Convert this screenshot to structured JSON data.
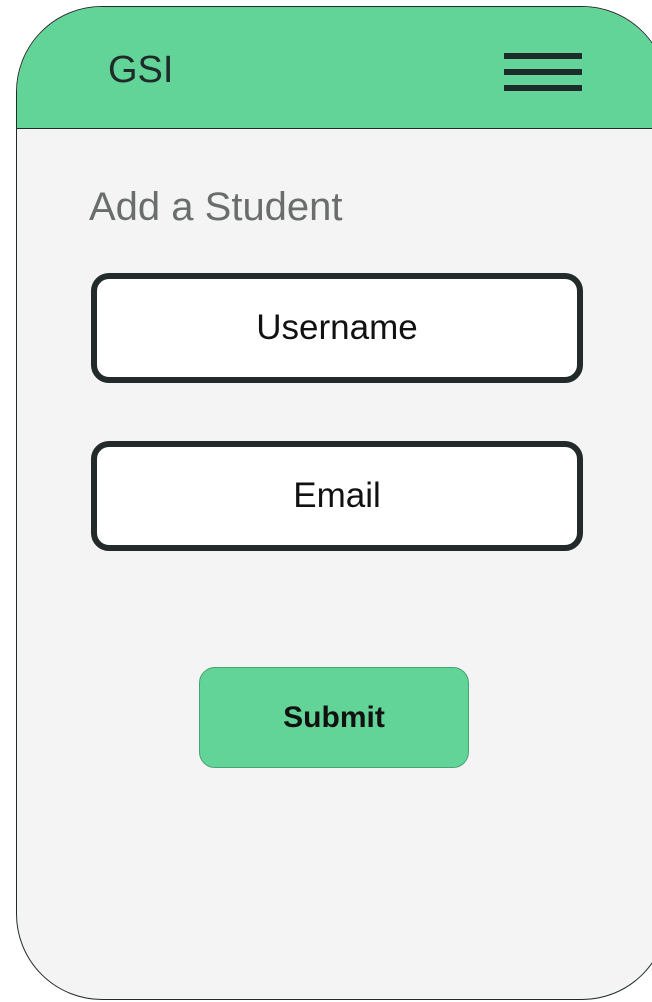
{
  "header": {
    "brand": "GSI",
    "menu_icon": "hamburger-menu-icon",
    "background_color": "#63d498"
  },
  "form": {
    "title": "Add a Student",
    "username": {
      "placeholder": "Username",
      "value": ""
    },
    "email": {
      "placeholder": "Email",
      "value": ""
    },
    "submit_label": "Submit"
  },
  "colors": {
    "accent": "#63d498",
    "outline": "#222a2a",
    "screen_background": "#f4f4f4",
    "title_text": "#6a6d6d"
  }
}
